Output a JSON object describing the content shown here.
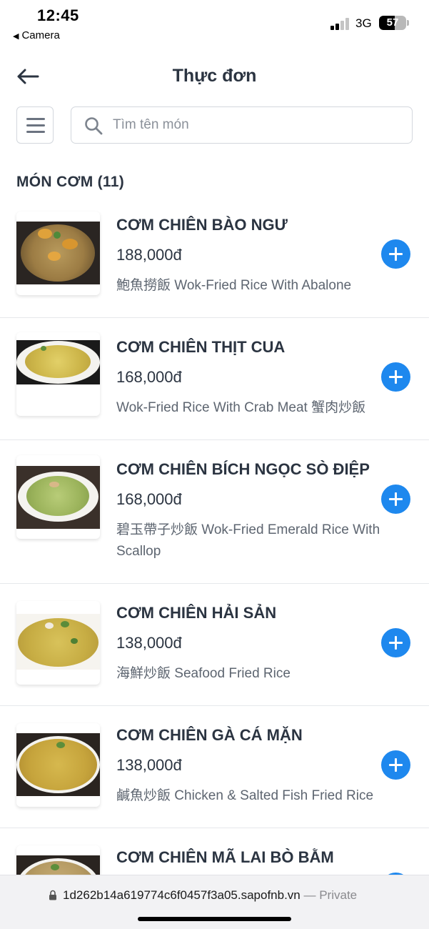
{
  "status_bar": {
    "time": "12:45",
    "back_label": "Camera",
    "network": "3G",
    "battery": "57",
    "battery_level": 0.57
  },
  "header": {
    "title": "Thực đơn"
  },
  "search": {
    "placeholder": "Tìm tên món"
  },
  "category": {
    "title": "MÓN CƠM (11)"
  },
  "items": [
    {
      "name": "CƠM CHIÊN BÀO NGƯ",
      "price": "188,000đ",
      "description": "鮑魚撈飯 Wok-Fried Rice With Abalone"
    },
    {
      "name": "CƠM CHIÊN THỊT CUA",
      "price": "168,000đ",
      "description": "Wok-Fried Rice With Crab Meat 蟹肉炒飯"
    },
    {
      "name": "CƠM CHIÊN BÍCH NGỌC SÒ ĐIỆP",
      "price": "168,000đ",
      "description": "碧玉帶子炒飯 Wok-Fried Emerald Rice With Scallop"
    },
    {
      "name": "CƠM CHIÊN HẢI SẢN",
      "price": "138,000đ",
      "description": "海鮮炒飯 Seafood Fried Rice"
    },
    {
      "name": "CƠM CHIÊN GÀ CÁ MẶN",
      "price": "138,000đ",
      "description": "鹹魚炒飯 Chicken & Salted Fish Fried Rice"
    },
    {
      "name": "CƠM CHIÊN MÃ LAI BÒ BẰM",
      "price": "",
      "description": ""
    }
  ],
  "browser": {
    "url": "1d262b14a619774c6f0457f3a05.sapofnb.vn",
    "suffix": " — Private"
  }
}
